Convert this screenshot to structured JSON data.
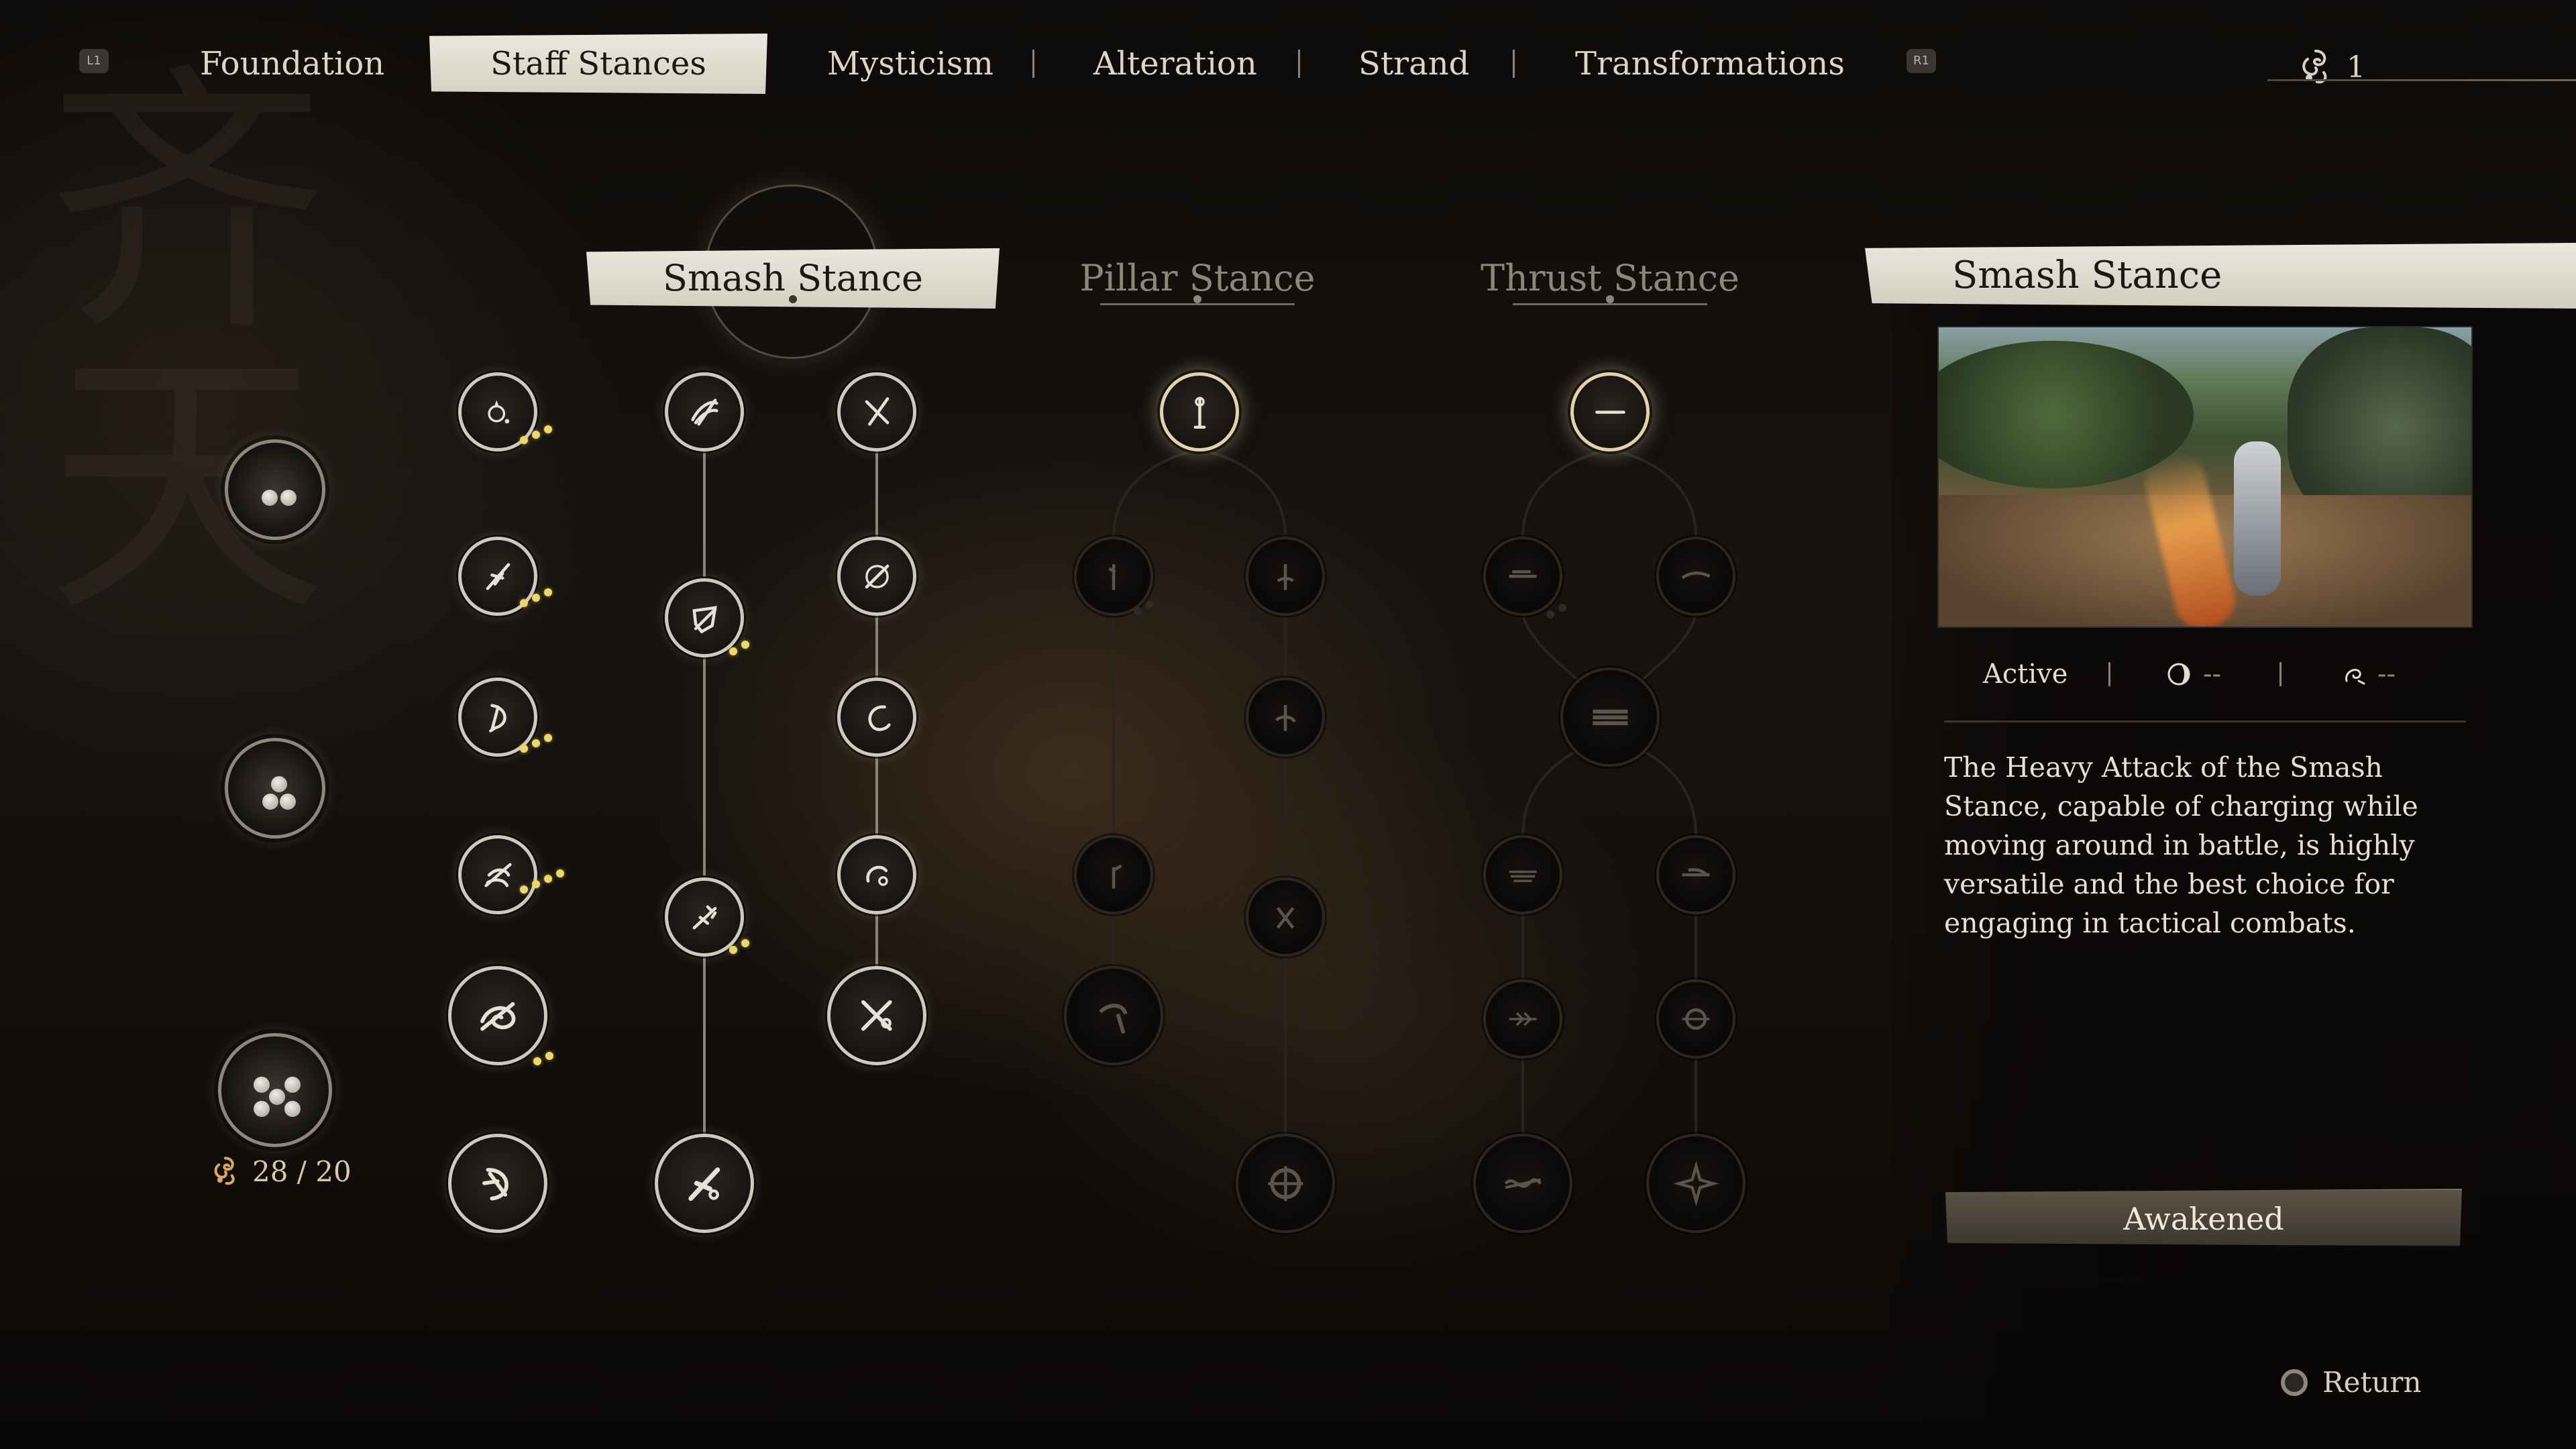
{
  "nav": {
    "left_hint": "L1",
    "right_hint": "R1",
    "tabs": [
      {
        "label": "Foundation",
        "active": false
      },
      {
        "label": "Staff Stances",
        "active": true
      },
      {
        "label": "Mysticism",
        "active": false
      },
      {
        "label": "Alteration",
        "active": false
      },
      {
        "label": "Strand",
        "active": false
      },
      {
        "label": "Transformations",
        "active": false
      }
    ],
    "currency_icon": "spark-swirl-icon",
    "currency_value": "1"
  },
  "stances": {
    "smash": "Smash Stance",
    "pillar": "Pillar Stance",
    "thrust": "Thrust Stance",
    "selected": "smash"
  },
  "points": {
    "icon": "spark-swirl-icon",
    "value": "28 / 20"
  },
  "detail": {
    "title": "Smash Stance",
    "status": "Active",
    "stat1_icon": "yin-moon-icon",
    "stat1_value": "--",
    "stat2_icon": "swirl-cost-icon",
    "stat2_value": "--",
    "description": "The Heavy Attack of the Smash Stance, capable of charging while moving around in battle, is highly versatile and the best choice for engaging in tactical combats.",
    "awaken_label": "Awakened"
  },
  "footer": {
    "return_label": "Return",
    "return_icon": "circle-button-icon"
  },
  "colors": {
    "accent_pip": "#ecd86a",
    "selected_tab_bg": "#e6e2d8",
    "background": "#0b0907"
  }
}
